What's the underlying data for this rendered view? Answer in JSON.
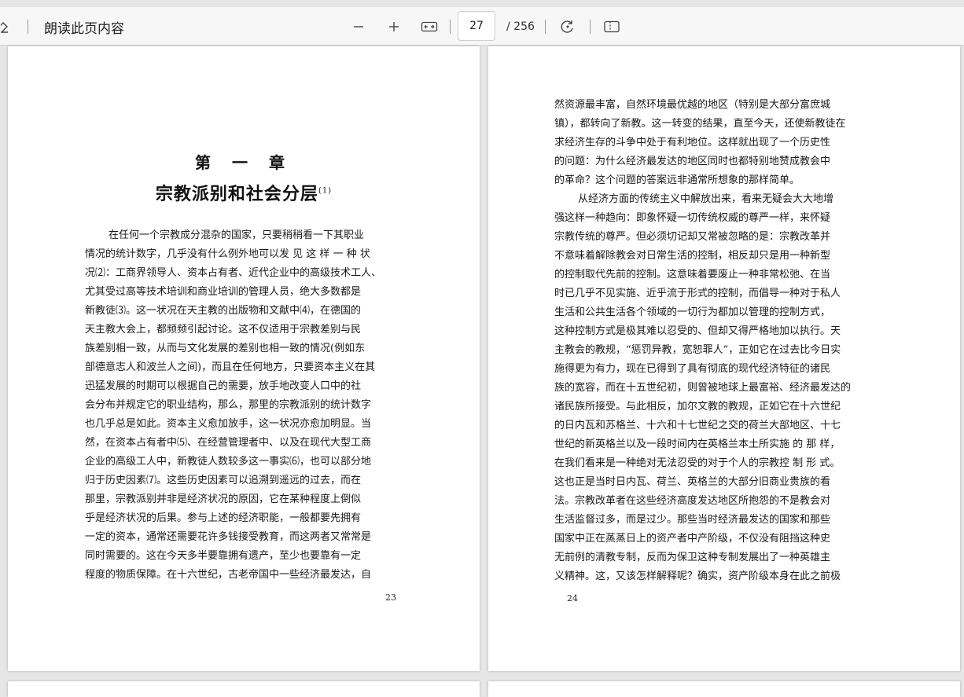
{
  "toolbar": {
    "read_aloud_label": "朗读此页内容",
    "current_page": "27",
    "total_pages": "/ 256"
  },
  "page_left": {
    "chapter_number": "第 一 章",
    "chapter_title": "宗教派别和社会分层",
    "chapter_title_note": "(1)",
    "lines": [
      "在任何一个宗教成分混杂的国家，只要稍稍看一下其职业",
      "情况的统计数字，几乎没有什么例外地可以发 见 这 样 一 种 状",
      "况⑵：工商界领导人、资本占有者、近代企业中的高级技术工人、",
      "尤其受过高等技术培训和商业培训的管理人员，绝大多数都是",
      "新教徒⑶。这一状况在天主教的出版物和文献中⑷，在德国的",
      "天主教大会上，都频频引起讨论。这不仅适用于宗教差别与民",
      "族差别相一致，从而与文化发展的差别也相一致的情况(例如东",
      "部德意志人和波兰人之间)，而且在任何地方，只要资本主义在其",
      "迅猛发展的时期可以根据自己的需要，放手地改变人口中的社",
      "会分布并规定它的职业结构，那么，那里的宗教派别的统计数字",
      "也几乎总是如此。资本主义愈加放手，这一状况亦愈加明显。当",
      "然，在资本占有者中⑸、在经营管理者中、以及在现代大型工商",
      "企业的高级工人中，新教徒人数较多这一事实⑹，也可以部分地",
      "归于历史因素⑺。这些历史因素可以追溯到遥远的过去，而在",
      "那里，宗教派别并非是经济状况的原因，它在某种程度上倒似",
      "乎是经济状况的后果。参与上述的经济职能，一般都要先拥有",
      "一定的资本，通常还需要花许多钱接受教育，而这两者又常常是",
      "同时需要的。这在今天多半要靠拥有遗产，至少也要靠有一定",
      "程度的物质保障。在十六世纪，古老帝国中一些经济最发达，自"
    ],
    "page_number": "23"
  },
  "page_right": {
    "lines": [
      "然资源最丰富，自然环境最优越的地区（特别是大部分富庶城",
      "镇），都转向了新教。这一转变的结果，直至今天，还使新教徒在",
      "求经济生存的斗争中处于有利地位。这样就出现了一个历史性",
      "的问题：为什么经济最发达的地区同时也都特别地赞成教会中",
      "的革命？这个问题的答案远非通常所想象的那样简单。",
      "从经济方面的传统主义中解放出来，看来无疑会大大地增",
      "强这样一种趋向：即象怀疑一切传统权威的尊严一样，来怀疑",
      "宗教传统的尊严。但必须切记却又常被忽略的是：宗教改革并",
      "不意味着解除教会对日常生活的控制，相反却只是用一种新型",
      "的控制取代先前的控制。这意味着要废止一种非常松弛、在当",
      "时已几乎不见实施、近乎流于形式的控制，而倡导一种对于私人",
      "生活和公共生活各个领域的一切行为都加以管理的控制方式，",
      "这种控制方式是极其难以忍受的、但却又得严格地加以执行。天",
      "主教会的教规，“惩罚异教，宽恕罪人”，正如它在过去比今日实",
      "施得更为有力，现在已得到了具有彻底的现代经济特征的诸民",
      "族的宽容，而在十五世纪初，则曾被地球上最富裕、经济最发达的",
      "诸民族所接受。与此相反，加尔文教的教规，正如它在十六世纪",
      "的日内瓦和苏格兰、十六和十七世纪之交的荷兰大部地区、十七",
      "世纪的新英格兰以及一段时间内在英格兰本土所实施 的 那 样，",
      "在我们看来是一种绝对无法忍受的对于个人的宗教控 制 形 式。",
      "这也正是当时日内瓦、荷兰、英格兰的大部分旧商业贵族的看",
      "法。宗教改革者在这些经济高度发达地区所抱怨的不是教会对",
      "生活监督过多，而是过少。那些当时经济最发达的国家和那些",
      "国家中正在蒸蒸日上的资产者中产阶级，不仅没有阻挡这种史",
      "无前例的清教专制，反而为保卫这种专制发展出了一种英雄主",
      "义精神。这，又该怎样解释呢？确实，资产阶级本身在此之前极"
    ],
    "page_number": "24"
  }
}
